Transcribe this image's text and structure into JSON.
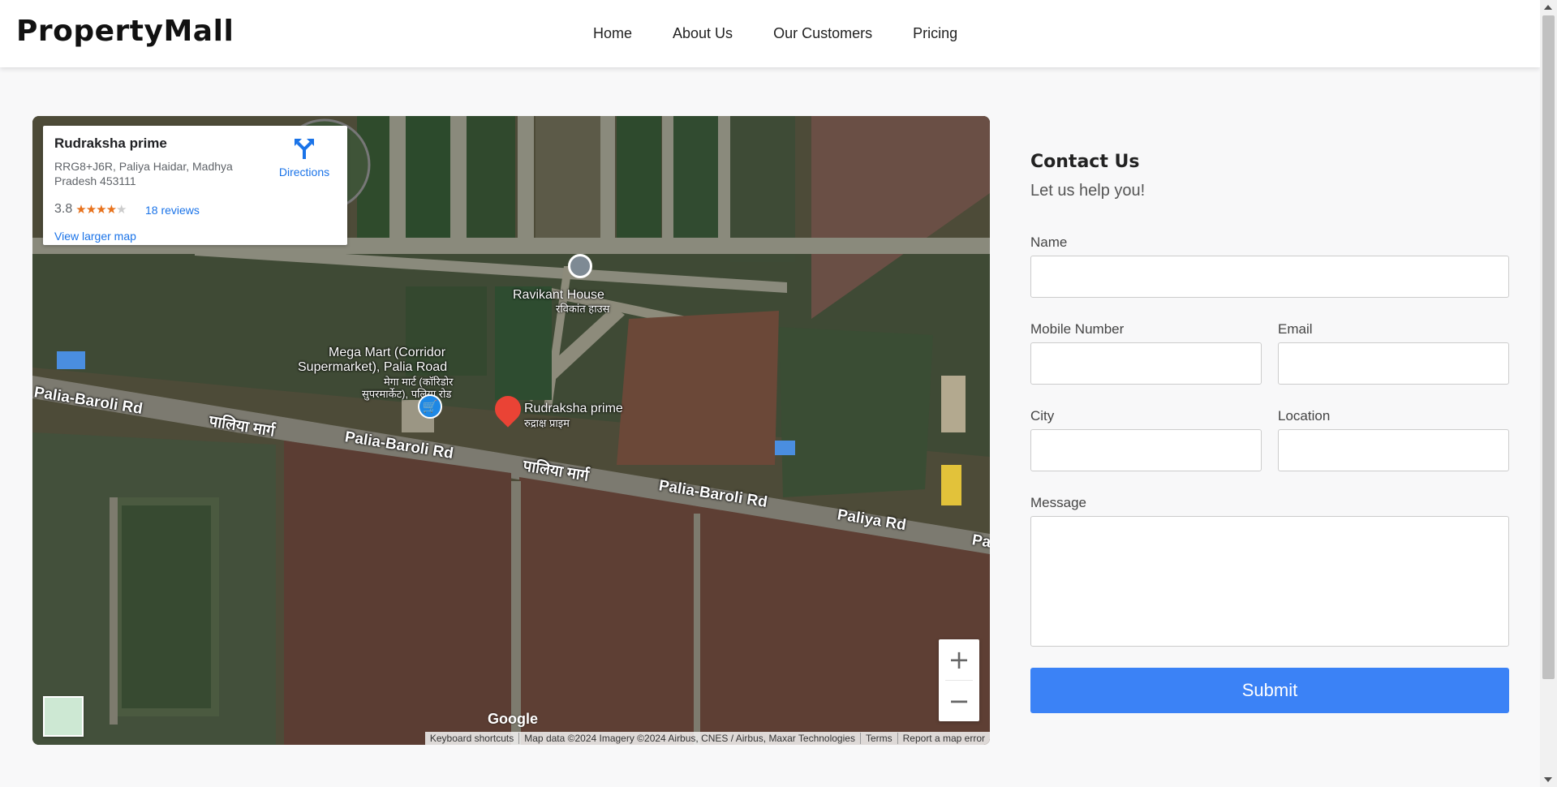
{
  "header": {
    "logo": "PropertyMall",
    "nav": [
      "Home",
      "About Us",
      "Our Customers",
      "Pricing"
    ]
  },
  "map": {
    "place_name": "Rudraksha prime",
    "address": "RRG8+J6R, Paliya Haidar, Madhya Pradesh 453111",
    "rating": "3.8",
    "stars": 3.8,
    "reviews": "18 reviews",
    "directions": "Directions",
    "larger_map": "View larger map",
    "labels": {
      "ravikant": "Ravikant House",
      "ravikant_hi": "रविकांत हाउस",
      "megamart_1": "Mega Mart (Corridor",
      "megamart_2": "Supermarket), Palia Road",
      "megamart_hi_1": "मेगा मार्ट (कॉरिडोर",
      "megamart_hi_2": "सुपरमार्केट), पलिया रोड",
      "pin": "Rudraksha prime",
      "pin_hi": "रुद्राक्ष प्राइम"
    },
    "roads": {
      "r1": "Palia-Baroli Rd",
      "r2": "पालिया मार्ग",
      "r3": "Palia-Baroli Rd",
      "r4": "पालिया मार्ग",
      "r5": "Palia-Baroli Rd",
      "r6": "Paliya Rd",
      "r7": "Pa"
    },
    "zoom_in": "+",
    "zoom_out": "−",
    "google": "Google",
    "attribution": [
      "Keyboard shortcuts",
      "Map data ©2024 Imagery ©2024 Airbus, CNES / Airbus, Maxar Technologies",
      "Terms",
      "Report a map error"
    ]
  },
  "contact": {
    "title": "Contact Us",
    "subtitle": "Let us help you!",
    "labels": {
      "name": "Name",
      "mobile": "Mobile Number",
      "email": "Email",
      "city": "City",
      "location": "Location",
      "message": "Message"
    },
    "submit": "Submit"
  },
  "colors": {
    "accent": "#3b82f6",
    "link": "#1a73e8",
    "star": "#e7711b",
    "pin": "#ea4335"
  }
}
